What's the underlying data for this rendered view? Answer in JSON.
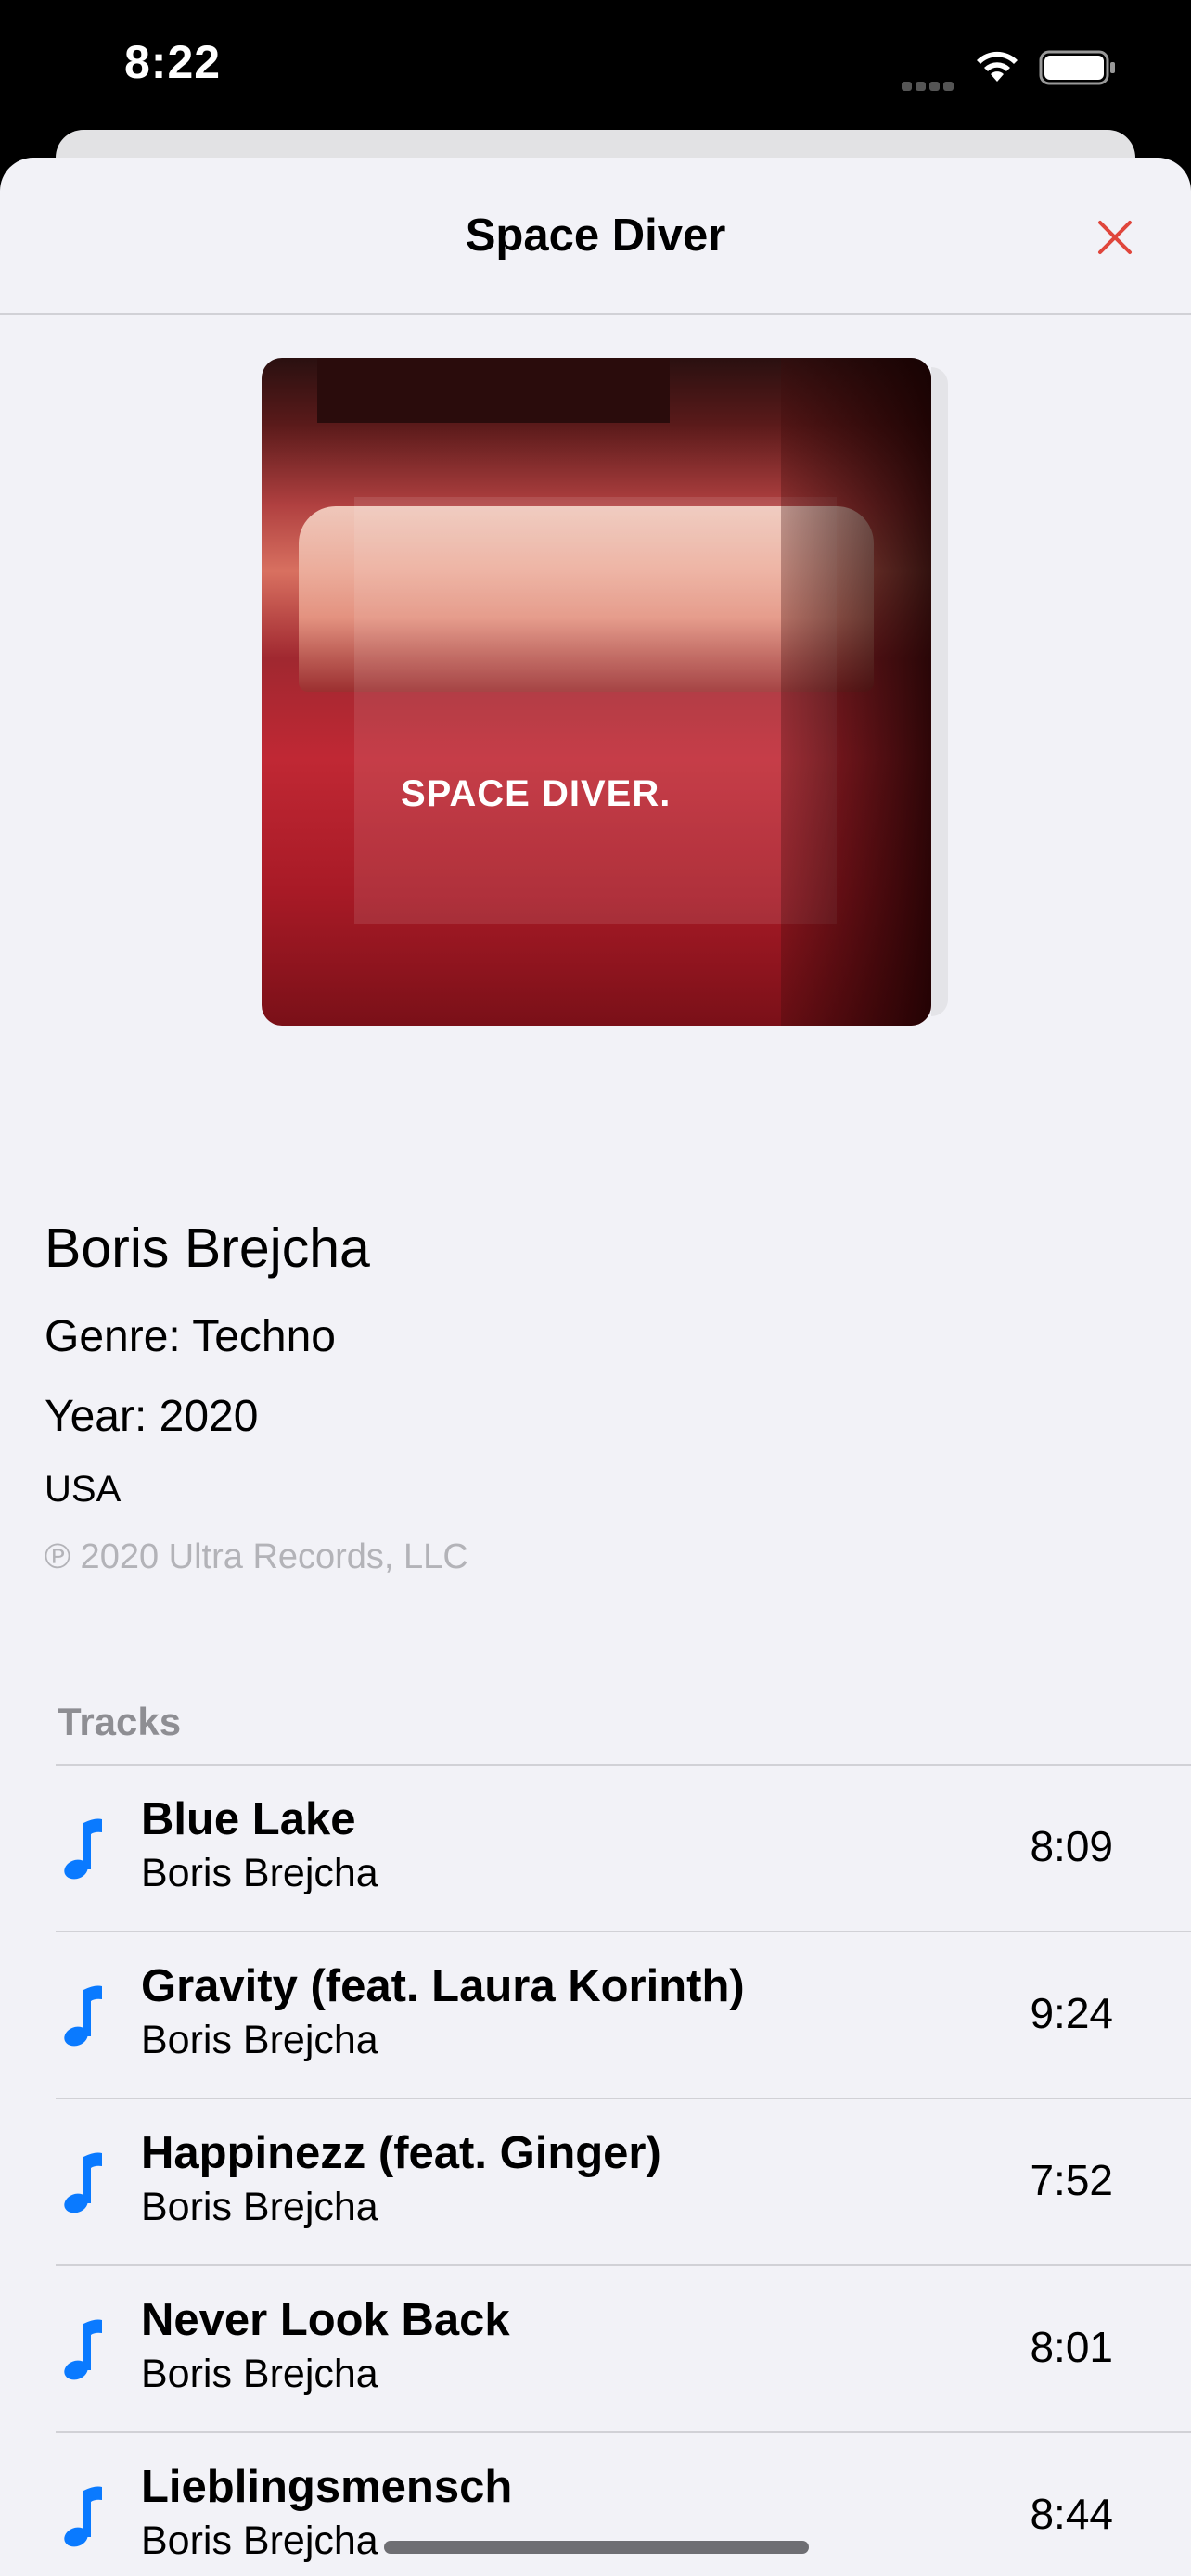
{
  "status": {
    "time": "8:22"
  },
  "nav": {
    "title": "Space Diver"
  },
  "album": {
    "cover_text": "SPACE DIVER.",
    "artist": "Boris Brejcha",
    "genre": "Genre: Techno",
    "year": "Year: 2020",
    "country": "USA",
    "copyright": "℗ 2020 Ultra Records, LLC"
  },
  "tracks": {
    "header": "Tracks",
    "items": [
      {
        "title": "Blue Lake",
        "artist": "Boris Brejcha",
        "duration": "8:09"
      },
      {
        "title": "Gravity (feat. Laura Korinth)",
        "artist": "Boris Brejcha",
        "duration": "9:24"
      },
      {
        "title": "Happinezz (feat. Ginger)",
        "artist": "Boris Brejcha",
        "duration": "7:52"
      },
      {
        "title": "Never Look Back",
        "artist": "Boris Brejcha",
        "duration": "8:01"
      },
      {
        "title": "Lieblingsmensch",
        "artist": "Boris Brejcha",
        "duration": "8:44"
      }
    ]
  },
  "colors": {
    "accent": "#0a7aff",
    "close": "#e0463c",
    "background": "#f2f2f7"
  },
  "icons": {
    "close": "close-icon",
    "track": "music-note-icon"
  }
}
